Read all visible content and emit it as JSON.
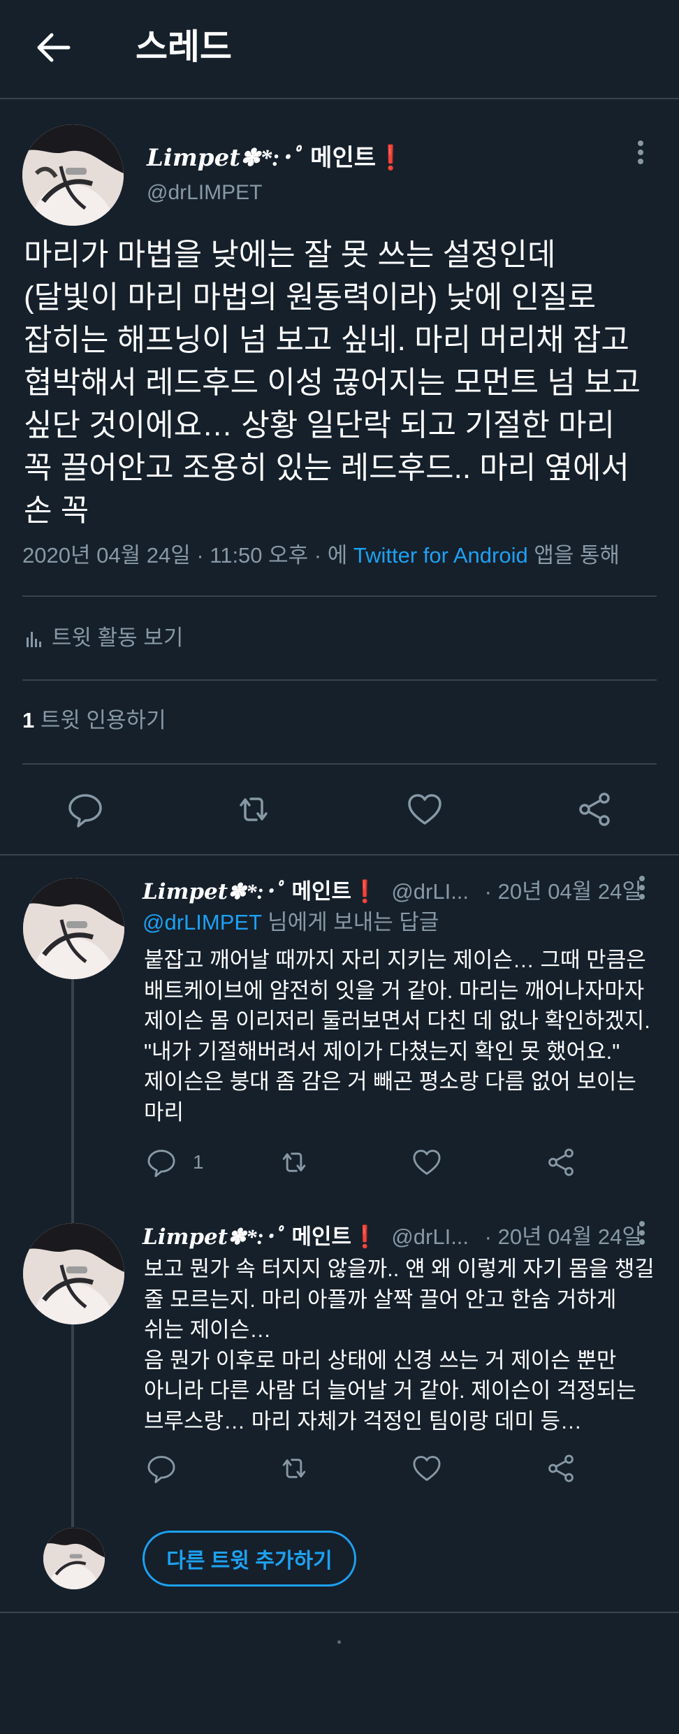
{
  "header": {
    "title": "스레드"
  },
  "main_tweet": {
    "name_deco": "𝑳𝒊𝒎𝒑𝒆𝒕✽*:･ﾟ",
    "name": "메인트",
    "name_mark": "❗",
    "handle": "@drLIMPET",
    "lines": [
      "마리가 마법을 낮에는 잘 못 쓰는 설정인데",
      "(달빛이 마리 마법의 원동력이라) 낮에 인질로",
      "잡히는 해프닝이 넘 보고 싶네. 마리 머리채 잡고",
      "협박해서 레드후드 이성 끊어지는 모먼트 넘 보고",
      "싶단 것이에요… 상황 일단락 되고 기절한 마리",
      "꼭 끌어안고 조용히 있는 레드후드.. 마리 옆에서",
      "손 꼭"
    ],
    "meta_date": "2020년 04월 24일 · 11:50 오후 · 에 ",
    "meta_app": "Twitter for Android",
    "meta_suffix": " 앱을 통해",
    "activity_label": "트윗 활동 보기",
    "quote_count": "1",
    "quote_label": " 트윗 인용하기"
  },
  "replies": [
    {
      "name_deco": "𝑳𝒊𝒎𝒑𝒆𝒕✽*:･ﾟ",
      "name": "메인트",
      "name_mark": "❗",
      "handle": "@drLI...",
      "date": "· 20년 04월 24일",
      "reply_to_handle": "@drLIMPET",
      "reply_to_suffix": " 님에게 보내는 답글",
      "lines": [
        "붙잡고 깨어날 때까지 자리 지키는 제이슨… 그때 만큼은",
        "배트케이브에 얌전히 잇을 거 같아. 마리는 깨어나자마자",
        "제이슨 몸 이리저리 둘러보면서 다친 데 없나 확인하겠지.",
        "\"내가 기절해버려서 제이가 다쳤는지 확인 못 했어요.\"",
        "제이슨은 붕대 좀 감은 거 빼곤 평소랑 다름 없어 보이는",
        "마리"
      ],
      "reply_count": "1"
    },
    {
      "name_deco": "𝑳𝒊𝒎𝒑𝒆𝒕✽*:･ﾟ",
      "name": "메인트",
      "name_mark": "❗",
      "handle": "@drLI...",
      "date": "· 20년 04월 24일",
      "lines": [
        "보고 뭔가 속 터지지 않을까.. 얜 왜 이렇게 자기 몸을 챙길",
        "줄 모르는지. 마리 아플까 살짝 끌어 안고 한숨 거하게",
        "쉬는 제이슨…",
        "음 뭔가 이후로 마리 상태에 신경 쓰는 거 제이슨 뿐만",
        "아니라 다른 사람 더 늘어날 거 같아. 제이슨이 걱정되는",
        "브루스랑… 마리 자체가 걱정인 팀이랑 데미 등…"
      ]
    }
  ],
  "add_tweet_button": "다른 트윗 추가하기",
  "colors": {
    "background": "#15202b",
    "accent": "#1da1f2",
    "secondary_text": "#8899a6",
    "divider": "#38444d",
    "mark": "#e0245e"
  }
}
